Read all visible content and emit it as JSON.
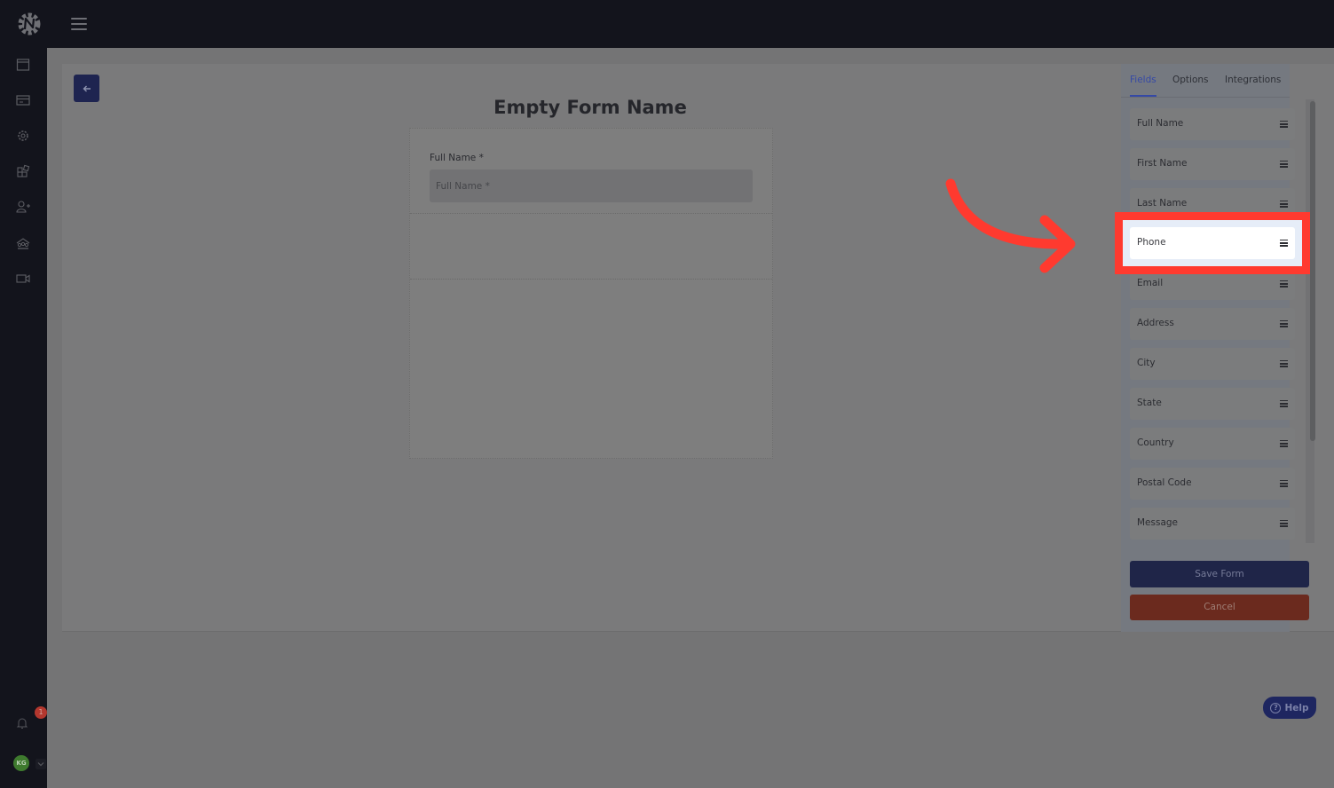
{
  "topbar": {
    "logo_icon": "gear-n-logo-icon",
    "menu_icon": "hamburger-menu-icon"
  },
  "sidebar": {
    "items": [
      {
        "icon": "browser-window-icon"
      },
      {
        "icon": "credit-card-icon"
      },
      {
        "icon": "settings-gear-icon"
      },
      {
        "icon": "integrations-puzzle-icon"
      },
      {
        "icon": "add-user-icon"
      },
      {
        "icon": "team-icon"
      },
      {
        "icon": "video-camera-icon"
      }
    ],
    "notifications": {
      "icon": "bell-icon",
      "count": "1"
    },
    "user": {
      "initials": "KG",
      "chevron_icon": "chevron-down-icon"
    }
  },
  "editor": {
    "back_icon": "arrow-left-icon",
    "form_title": "Empty Form Name",
    "fields": [
      {
        "label": "Full Name *",
        "placeholder": "Full Name *",
        "value": ""
      }
    ]
  },
  "panel": {
    "tabs": [
      {
        "label": "Fields",
        "active": true
      },
      {
        "label": "Options",
        "active": false
      },
      {
        "label": "Integrations",
        "active": false
      }
    ],
    "field_types": [
      {
        "label": "Full Name"
      },
      {
        "label": "First Name"
      },
      {
        "label": "Last Name"
      },
      {
        "label": "Phone",
        "highlighted": true
      },
      {
        "label": "Email"
      },
      {
        "label": "Address"
      },
      {
        "label": "City"
      },
      {
        "label": "State"
      },
      {
        "label": "Country"
      },
      {
        "label": "Postal Code"
      },
      {
        "label": "Message"
      }
    ],
    "save_label": "Save Form",
    "cancel_label": "Cancel"
  },
  "annotation": {
    "target": "Phone",
    "color": "#ff3a2f"
  },
  "help": {
    "label": "Help",
    "icon_glyph": "?"
  },
  "colors": {
    "primary": "#1e2450",
    "danger": "#6b2a1e",
    "accent_tab": "#3549a6",
    "sidebar_bg": "#13141c"
  }
}
